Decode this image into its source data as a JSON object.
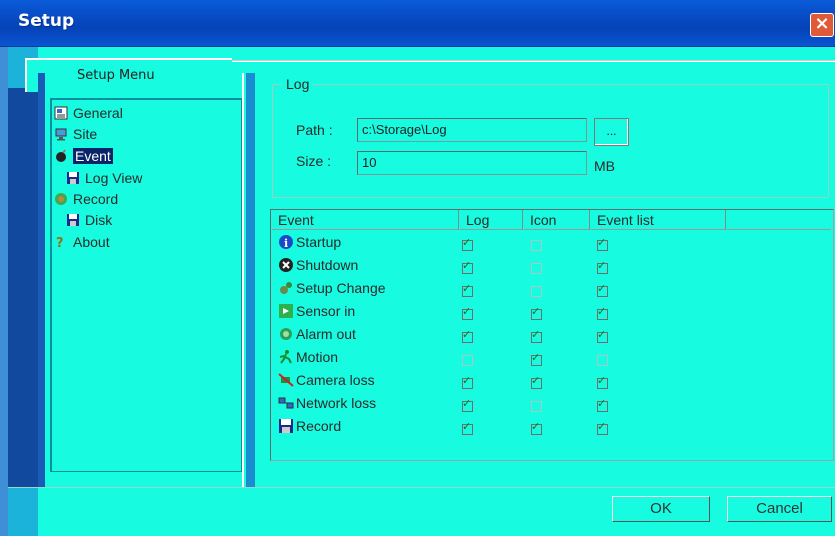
{
  "window": {
    "title": "Setup"
  },
  "tab": {
    "label": "Setup Menu"
  },
  "tree": [
    {
      "label": "General",
      "icon": "general-icon"
    },
    {
      "label": "Site",
      "icon": "site-icon"
    },
    {
      "label": "Event",
      "icon": "event-icon",
      "selected": true
    },
    {
      "label": "Log View",
      "icon": "disk-icon"
    },
    {
      "label": "Record",
      "icon": "record-icon"
    },
    {
      "label": "Disk",
      "icon": "disk-icon"
    },
    {
      "label": "About",
      "icon": "question-icon"
    }
  ],
  "log": {
    "legend": "Log",
    "path_label": "Path :",
    "path_value": "c:\\Storage\\Log",
    "size_label": "Size :",
    "size_value": "10",
    "size_unit": "MB",
    "browse_label": "..."
  },
  "events": {
    "columns": [
      "Event",
      "Log",
      "Icon",
      "Event list"
    ],
    "rows": [
      {
        "name": "Startup",
        "log": true,
        "icon": false,
        "list": true
      },
      {
        "name": "Shutdown",
        "log": true,
        "icon": false,
        "list": true
      },
      {
        "name": "Setup Change",
        "log": true,
        "icon": false,
        "list": true
      },
      {
        "name": "Sensor in",
        "log": true,
        "icon": true,
        "list": true
      },
      {
        "name": "Alarm out",
        "log": true,
        "icon": true,
        "list": true
      },
      {
        "name": "Motion",
        "log": false,
        "icon": true,
        "list": false
      },
      {
        "name": "Camera loss",
        "log": true,
        "icon": true,
        "list": true
      },
      {
        "name": "Network loss",
        "log": true,
        "icon": false,
        "list": true
      },
      {
        "name": "Record",
        "log": true,
        "icon": true,
        "list": true
      }
    ]
  },
  "buttons": {
    "ok": "OK",
    "cancel": "Cancel"
  },
  "colors": {
    "background": "#17fbe0",
    "titlebar": "#0542b8",
    "selection": "#0a246a"
  }
}
